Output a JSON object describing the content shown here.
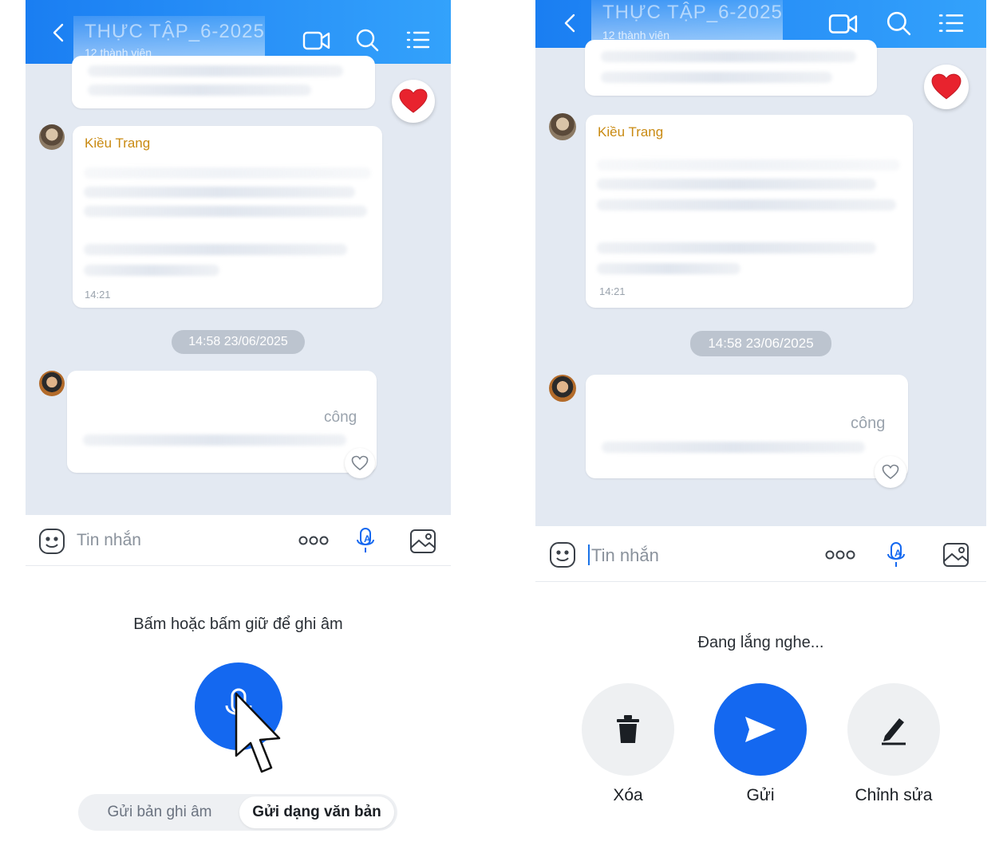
{
  "header": {
    "title": "THỰC TẬP_6-2025",
    "subtitle": "12 thành viên"
  },
  "chat": {
    "sender_name": "Kiều Trang",
    "message_time": "14:21",
    "timestamp_divider": "14:58 23/06/2025",
    "partial_word": "công"
  },
  "input": {
    "placeholder": "Tin nhắn"
  },
  "left_panel": {
    "hint": "Bấm hoặc bấm giữ để ghi âm",
    "toggle_voice": "Gửi bản ghi âm",
    "toggle_text": "Gửi dạng văn bản",
    "selected_mode": "Gửi dạng văn bản"
  },
  "right_panel": {
    "status": "Đang lắng nghe...",
    "delete_label": "Xóa",
    "send_label": "Gửi",
    "edit_label": "Chỉnh sửa"
  },
  "colors": {
    "header_blue": "#1a7ef2",
    "primary_blue": "#1468f0",
    "chat_bg": "#e3e9f2",
    "sender_name": "#c98a12",
    "heart": "#e8232e"
  },
  "icons": [
    "back-arrow-icon",
    "video-call-icon",
    "search-icon",
    "menu-list-icon",
    "sticker-icon",
    "more-options-icon",
    "voice-to-text-icon",
    "image-icon",
    "heart-icon",
    "mic-icon",
    "trash-icon",
    "send-icon",
    "edit-pencil-icon",
    "mouse-cursor-icon"
  ]
}
